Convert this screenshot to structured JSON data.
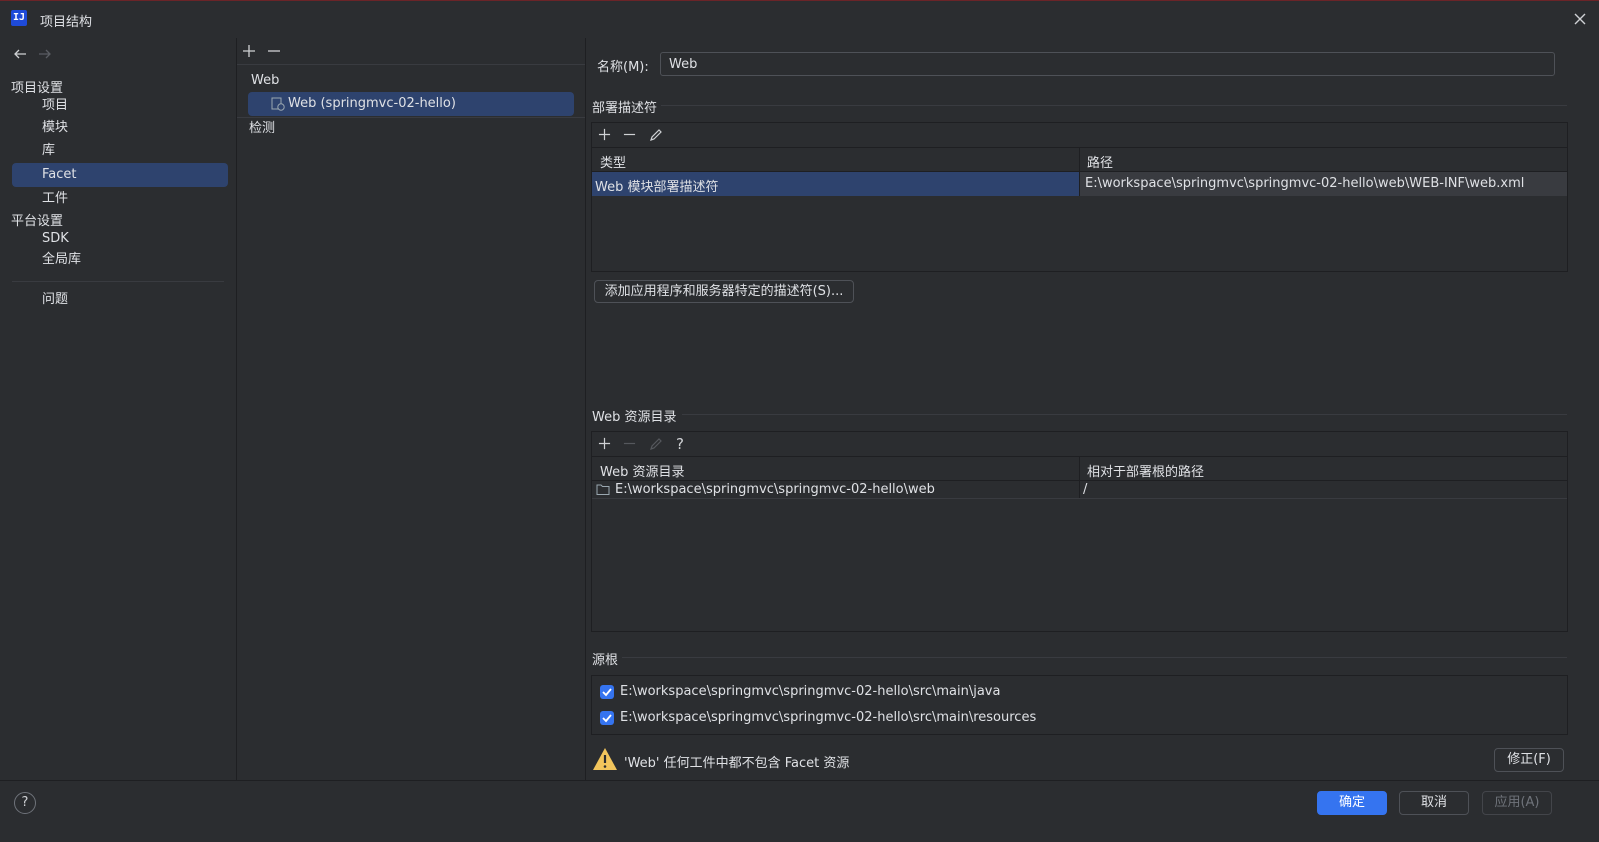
{
  "window": {
    "title": "项目结构",
    "app_icon": "IJ"
  },
  "left_nav": {
    "project_settings_header": "项目设置",
    "project_items": [
      {
        "label": "项目",
        "selected": false
      },
      {
        "label": "模块",
        "selected": false
      },
      {
        "label": "库",
        "selected": false
      },
      {
        "label": "Facet",
        "selected": true
      },
      {
        "label": "工件",
        "selected": false
      }
    ],
    "platform_settings_header": "平台设置",
    "platform_items": [
      {
        "label": "SDK"
      },
      {
        "label": "全局库"
      }
    ],
    "problems_label": "问题"
  },
  "middle": {
    "toolbar": {
      "add": "+",
      "remove": "−"
    },
    "group_label": "Web",
    "facet_item": "Web (springmvc-02-hello)",
    "detection_label": "检测"
  },
  "details": {
    "name_label": "名称(M):",
    "name_value": "Web",
    "deployment_section": {
      "title": "部署描述符",
      "columns": [
        "类型",
        "路径"
      ],
      "rows": [
        {
          "type": "Web 模块部署描述符",
          "path": "E:\\workspace\\springmvc\\springmvc-02-hello\\web\\WEB-INF\\web.xml"
        }
      ],
      "add_button": "添加应用程序和服务器特定的描述符(S)..."
    },
    "web_resource_section": {
      "title": "Web 资源目录",
      "columns": [
        "Web 资源目录",
        "相对于部署根的路径"
      ],
      "rows": [
        {
          "dir": "E:\\workspace\\springmvc\\springmvc-02-hello\\web",
          "rel": "/"
        }
      ],
      "help_glyph": "?"
    },
    "source_roots_section": {
      "title": "源根",
      "items": [
        {
          "path": "E:\\workspace\\springmvc\\springmvc-02-hello\\src\\main\\java",
          "checked": true
        },
        {
          "path": "E:\\workspace\\springmvc\\springmvc-02-hello\\src\\main\\resources",
          "checked": true
        }
      ]
    },
    "warning": {
      "text": "'Web' 任何工件中都不包含 Facet 资源",
      "fix_button": "修正(F)"
    }
  },
  "footer": {
    "help": "?",
    "ok": "确定",
    "cancel": "取消",
    "apply": "应用(A)"
  },
  "colors": {
    "background": "#2b2d30",
    "selection": "#2e436e",
    "accent": "#3574f0",
    "warning": "#f2c55c"
  }
}
